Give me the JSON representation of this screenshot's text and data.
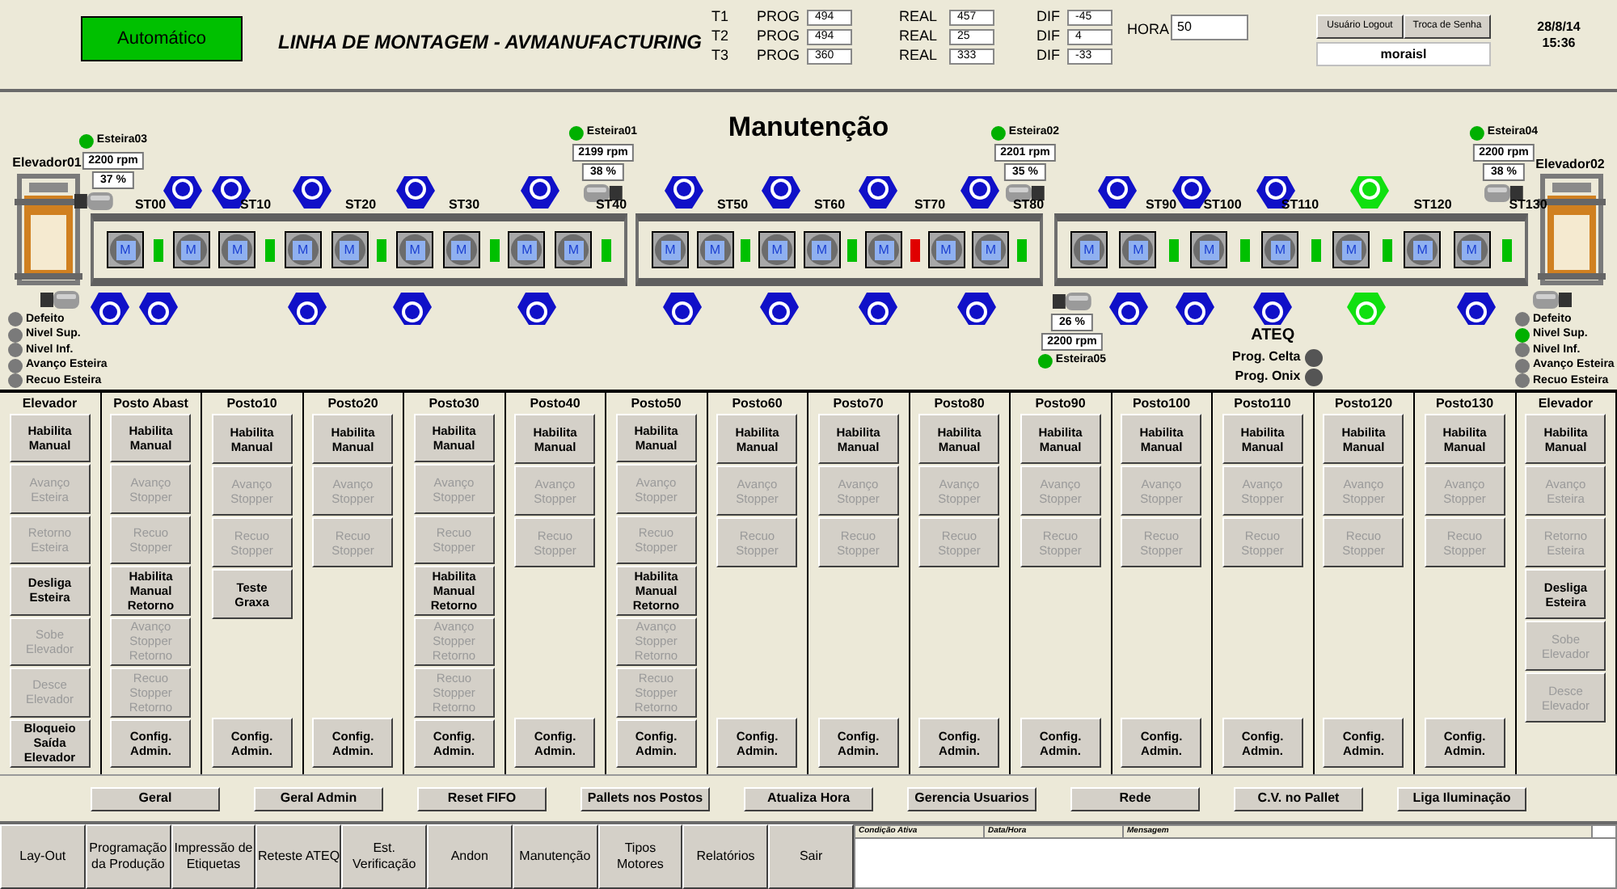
{
  "header": {
    "mode": "Automático",
    "title": "LINHA DE MONTAGEM - AVMANUFACTURING",
    "counters": [
      {
        "turn": "T1",
        "prog_label": "PROG",
        "prog": "494",
        "real_label": "REAL",
        "real": "457",
        "dif_label": "DIF",
        "dif": "-45"
      },
      {
        "turn": "T2",
        "prog_label": "PROG",
        "prog": "494",
        "real_label": "REAL",
        "real": "25",
        "dif_label": "DIF",
        "dif": "4"
      },
      {
        "turn": "T3",
        "prog_label": "PROG",
        "prog": "360",
        "real_label": "REAL",
        "real": "333",
        "dif_label": "DIF",
        "dif": "-33"
      }
    ],
    "hora": {
      "label": "HORA",
      "value": "50"
    },
    "user_buttons": [
      "Usuário Logout",
      "Troca de Senha"
    ],
    "user": "moraisl",
    "date": "28/8/14",
    "time": "15:36"
  },
  "diagram": {
    "title": "Manutenção",
    "elevators": [
      {
        "name": "Elevador01",
        "signals": [
          {
            "label": "Defeito",
            "on": false
          },
          {
            "label": "Nivel Sup.",
            "on": false
          },
          {
            "label": "Nivel Inf.",
            "on": false
          },
          {
            "label": "Avanço Esteira",
            "on": false
          },
          {
            "label": "Recuo Esteira",
            "on": false
          }
        ]
      },
      {
        "name": "Elevador02",
        "signals": [
          {
            "label": "Defeito",
            "on": false
          },
          {
            "label": "Nivel Sup.",
            "on": true
          },
          {
            "label": "Nivel Inf.",
            "on": false
          },
          {
            "label": "Avanço Esteira",
            "on": false
          },
          {
            "label": "Recuo Esteira",
            "on": false
          }
        ]
      }
    ],
    "conveyors": [
      {
        "name": "Esteira03",
        "running": true,
        "rpm": "2200 rpm",
        "load": "37 %"
      },
      {
        "name": "Esteira01",
        "running": true,
        "rpm": "2199 rpm",
        "load": "38 %"
      },
      {
        "name": "Esteira02",
        "running": true,
        "rpm": "2201 rpm",
        "load": "35 %"
      },
      {
        "name": "Esteira04",
        "running": true,
        "rpm": "2200 rpm",
        "load": "38 %"
      },
      {
        "name": "Esteira05",
        "running": true,
        "rpm": "2200 rpm",
        "load": "26 %"
      }
    ],
    "stations": [
      "ST00",
      "ST10",
      "ST20",
      "ST30",
      "ST40",
      "ST50",
      "ST60",
      "ST70",
      "ST80",
      "ST90",
      "ST100",
      "ST110",
      "ST120",
      "ST130"
    ],
    "segments": [
      {
        "items": [
          {
            "kind": "pallet",
            "label": "M"
          },
          {
            "kind": "stopper",
            "color": "#00c000"
          },
          {
            "kind": "pallet",
            "label": "M"
          },
          {
            "kind": "pallet",
            "label": "M"
          },
          {
            "kind": "stopper",
            "color": "#00c000"
          },
          {
            "kind": "pallet",
            "label": "M"
          },
          {
            "kind": "pallet",
            "label": "M"
          },
          {
            "kind": "stopper",
            "color": "#00c000"
          },
          {
            "kind": "pallet",
            "label": "M"
          },
          {
            "kind": "pallet",
            "label": "M"
          },
          {
            "kind": "stopper",
            "color": "#00c000"
          },
          {
            "kind": "pallet",
            "label": "M"
          },
          {
            "kind": "pallet",
            "label": "M"
          },
          {
            "kind": "stopper",
            "color": "#00c000"
          }
        ]
      },
      {
        "items": [
          {
            "kind": "pallet",
            "label": "M"
          },
          {
            "kind": "pallet",
            "label": "M"
          },
          {
            "kind": "stopper",
            "color": "#00c000"
          },
          {
            "kind": "pallet",
            "label": "M"
          },
          {
            "kind": "pallet",
            "label": "M"
          },
          {
            "kind": "stopper",
            "color": "#00c000"
          },
          {
            "kind": "pallet",
            "label": "M"
          },
          {
            "kind": "stopper",
            "color": "#e00000"
          },
          {
            "kind": "pallet",
            "label": "M"
          },
          {
            "kind": "pallet",
            "label": "M"
          },
          {
            "kind": "stopper",
            "color": "#00c000"
          }
        ]
      },
      {
        "items": [
          {
            "kind": "pallet",
            "label": "M"
          },
          {
            "kind": "pallet",
            "label": "M"
          },
          {
            "kind": "stopper",
            "color": "#00c000"
          },
          {
            "kind": "pallet",
            "label": "M"
          },
          {
            "kind": "stopper",
            "color": "#00c000"
          },
          {
            "kind": "pallet",
            "label": "M"
          },
          {
            "kind": "stopper",
            "color": "#00c000"
          },
          {
            "kind": "pallet",
            "label": "M"
          },
          {
            "kind": "stopper",
            "color": "#00c000"
          },
          {
            "kind": "pallet",
            "label": "M"
          },
          {
            "kind": "pallet",
            "label": "M"
          },
          {
            "kind": "stopper",
            "color": "#00c000"
          }
        ]
      }
    ],
    "robots_top": [
      {
        "active": false
      },
      {
        "active": false
      },
      {
        "active": false
      },
      {
        "active": false
      },
      {
        "active": false
      },
      {
        "active": false
      },
      {
        "active": false
      },
      {
        "active": false
      },
      {
        "active": false
      },
      {
        "active": false
      },
      {
        "active": false
      },
      {
        "active": false
      },
      {
        "active": true
      }
    ],
    "robots_bottom": [
      {
        "active": false
      },
      {
        "active": false
      },
      {
        "active": false
      },
      {
        "active": false
      },
      {
        "active": false
      },
      {
        "active": false
      },
      {
        "active": false
      },
      {
        "active": false
      },
      {
        "active": false
      },
      {
        "active": false
      },
      {
        "active": false
      },
      {
        "active": false
      },
      {
        "active": true
      },
      {
        "active": false
      }
    ],
    "ateq": {
      "title": "ATEQ",
      "programs": [
        {
          "label": "Prog. Celta",
          "on": false
        },
        {
          "label": "Prog. Onix",
          "on": false
        }
      ]
    }
  },
  "stations_panel": [
    {
      "title": "Elevador",
      "buttons": [
        {
          "label": "Habilita\nManual",
          "disabled": false
        },
        {
          "label": "Avanço\nEsteira",
          "disabled": true
        },
        {
          "label": "Retorno\nEsteira",
          "disabled": true
        },
        {
          "label": "Desliga\nEsteira",
          "disabled": false
        },
        {
          "label": "Sobe\nElevador",
          "disabled": true
        },
        {
          "label": "Desce\nElevador",
          "disabled": true
        }
      ],
      "bottom_button": {
        "label": "Bloqueio\nSaída\nElevador",
        "disabled": false
      }
    },
    {
      "title": "Posto Abast",
      "buttons": [
        {
          "label": "Habilita\nManual",
          "disabled": false
        },
        {
          "label": "Avanço\nStopper",
          "disabled": true
        },
        {
          "label": "Recuo\nStopper",
          "disabled": true
        },
        {
          "label": "Habilita\nManual\nRetorno",
          "disabled": false
        },
        {
          "label": "Avanço\nStopper\nRetorno",
          "disabled": true
        },
        {
          "label": "Recuo\nStopper\nRetorno",
          "disabled": true
        }
      ],
      "bottom_button": {
        "label": "Config.\nAdmin.",
        "disabled": false
      }
    },
    {
      "title": "Posto10",
      "buttons": [
        {
          "label": "Habilita\nManual",
          "disabled": false
        },
        {
          "label": "Avanço\nStopper",
          "disabled": true
        },
        {
          "label": "Recuo\nStopper",
          "disabled": true
        },
        {
          "label": "Teste\nGraxa",
          "disabled": false
        }
      ],
      "bottom_button": {
        "label": "Config.\nAdmin.",
        "disabled": false
      }
    },
    {
      "title": "Posto20",
      "buttons": [
        {
          "label": "Habilita\nManual",
          "disabled": false
        },
        {
          "label": "Avanço\nStopper",
          "disabled": true
        },
        {
          "label": "Recuo\nStopper",
          "disabled": true
        }
      ],
      "bottom_button": {
        "label": "Config.\nAdmin.",
        "disabled": false
      }
    },
    {
      "title": "Posto30",
      "buttons": [
        {
          "label": "Habilita\nManual",
          "disabled": false
        },
        {
          "label": "Avanço\nStopper",
          "disabled": true
        },
        {
          "label": "Recuo\nStopper",
          "disabled": true
        },
        {
          "label": "Habilita\nManual\nRetorno",
          "disabled": false
        },
        {
          "label": "Avanço\nStopper\nRetorno",
          "disabled": true
        },
        {
          "label": "Recuo\nStopper\nRetorno",
          "disabled": true
        }
      ],
      "bottom_button": {
        "label": "Config.\nAdmin.",
        "disabled": false
      }
    },
    {
      "title": "Posto40",
      "buttons": [
        {
          "label": "Habilita\nManual",
          "disabled": false
        },
        {
          "label": "Avanço\nStopper",
          "disabled": true
        },
        {
          "label": "Recuo\nStopper",
          "disabled": true
        }
      ],
      "bottom_button": {
        "label": "Config.\nAdmin.",
        "disabled": false
      }
    },
    {
      "title": "Posto50",
      "buttons": [
        {
          "label": "Habilita\nManual",
          "disabled": false
        },
        {
          "label": "Avanço\nStopper",
          "disabled": true
        },
        {
          "label": "Recuo\nStopper",
          "disabled": true
        },
        {
          "label": "Habilita\nManual\nRetorno",
          "disabled": false
        },
        {
          "label": "Avanço\nStopper\nRetorno",
          "disabled": true
        },
        {
          "label": "Recuo\nStopper\nRetorno",
          "disabled": true
        }
      ],
      "bottom_button": {
        "label": "Config.\nAdmin.",
        "disabled": false
      }
    },
    {
      "title": "Posto60",
      "buttons": [
        {
          "label": "Habilita\nManual",
          "disabled": false
        },
        {
          "label": "Avanço\nStopper",
          "disabled": true
        },
        {
          "label": "Recuo\nStopper",
          "disabled": true
        }
      ],
      "bottom_button": {
        "label": "Config.\nAdmin.",
        "disabled": false
      }
    },
    {
      "title": "Posto70",
      "buttons": [
        {
          "label": "Habilita\nManual",
          "disabled": false
        },
        {
          "label": "Avanço\nStopper",
          "disabled": true
        },
        {
          "label": "Recuo\nStopper",
          "disabled": true
        }
      ],
      "bottom_button": {
        "label": "Config.\nAdmin.",
        "disabled": false
      }
    },
    {
      "title": "Posto80",
      "buttons": [
        {
          "label": "Habilita\nManual",
          "disabled": false
        },
        {
          "label": "Avanço\nStopper",
          "disabled": true
        },
        {
          "label": "Recuo\nStopper",
          "disabled": true
        }
      ],
      "bottom_button": {
        "label": "Config.\nAdmin.",
        "disabled": false
      }
    },
    {
      "title": "Posto90",
      "buttons": [
        {
          "label": "Habilita\nManual",
          "disabled": false
        },
        {
          "label": "Avanço\nStopper",
          "disabled": true
        },
        {
          "label": "Recuo\nStopper",
          "disabled": true
        }
      ],
      "bottom_button": {
        "label": "Config.\nAdmin.",
        "disabled": false
      }
    },
    {
      "title": "Posto100",
      "buttons": [
        {
          "label": "Habilita\nManual",
          "disabled": false
        },
        {
          "label": "Avanço\nStopper",
          "disabled": true
        },
        {
          "label": "Recuo\nStopper",
          "disabled": true
        }
      ],
      "bottom_button": {
        "label": "Config.\nAdmin.",
        "disabled": false
      }
    },
    {
      "title": "Posto110",
      "buttons": [
        {
          "label": "Habilita\nManual",
          "disabled": false
        },
        {
          "label": "Avanço\nStopper",
          "disabled": true
        },
        {
          "label": "Recuo\nStopper",
          "disabled": true
        }
      ],
      "bottom_button": {
        "label": "Config.\nAdmin.",
        "disabled": false
      }
    },
    {
      "title": "Posto120",
      "buttons": [
        {
          "label": "Habilita\nManual",
          "disabled": false
        },
        {
          "label": "Avanço\nStopper",
          "disabled": true
        },
        {
          "label": "Recuo\nStopper",
          "disabled": true
        }
      ],
      "bottom_button": {
        "label": "Config.\nAdmin.",
        "disabled": false
      }
    },
    {
      "title": "Posto130",
      "buttons": [
        {
          "label": "Habilita\nManual",
          "disabled": false
        },
        {
          "label": "Avanço\nStopper",
          "disabled": true
        },
        {
          "label": "Recuo\nStopper",
          "disabled": true
        }
      ],
      "bottom_button": {
        "label": "Config.\nAdmin.",
        "disabled": false
      }
    },
    {
      "title": "Elevador",
      "buttons": [
        {
          "label": "Habilita\nManual",
          "disabled": false
        },
        {
          "label": "Avanço\nEsteira",
          "disabled": true
        },
        {
          "label": "Retorno\nEsteira",
          "disabled": true
        },
        {
          "label": "Desliga\nEsteira",
          "disabled": false
        },
        {
          "label": "Sobe\nElevador",
          "disabled": true
        },
        {
          "label": "Desce\nElevador",
          "disabled": true
        }
      ]
    }
  ],
  "function_buttons": [
    "Geral",
    "Geral Admin",
    "Reset FIFO",
    "Pallets nos Postos",
    "Atualiza Hora",
    "Gerencia Usuarios",
    "Rede",
    "C.V. no Pallet",
    "Liga Iluminação"
  ],
  "nav_tabs": [
    "Lay-Out",
    "Programação\nda Produção",
    "Impressão de\nEtiquetas",
    "Reteste ATEQ",
    "Est.\nVerificação",
    "Andon",
    "Manutenção",
    "Tipos\nMotores",
    "Relatórios",
    "Sair"
  ],
  "messages": {
    "columns": [
      "Condição Ativa",
      "Data/Hora",
      "Mensagem"
    ]
  }
}
